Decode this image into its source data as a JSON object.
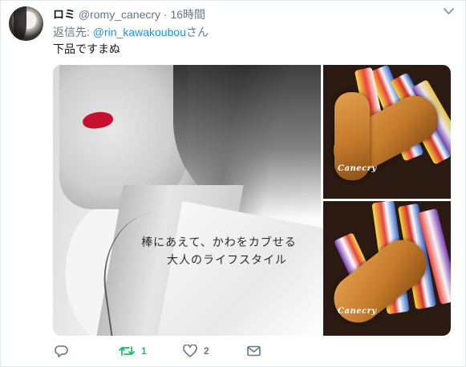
{
  "tweet": {
    "display_name": "ロミ",
    "handle": "@romy_canecry",
    "separator": "·",
    "time": "16時間",
    "reply_prefix": "返信先: ",
    "reply_to": "@rin_kawakoubou",
    "reply_suffix": "さん",
    "text": "下品ですまぬ"
  },
  "media": {
    "poster_line1": "棒にあえて、かわをカブせる",
    "poster_line2": "大人のライフスタイル",
    "brand_top": "Canecry",
    "brand_bottom": "Canecry"
  },
  "actions": {
    "reply_icon": "reply-icon",
    "retweet_icon": "retweet-icon",
    "retweet_count": "1",
    "like_icon": "heart-icon",
    "like_count": "2",
    "dm_icon": "envelope-icon",
    "retweet_color": "#17bf63",
    "icon_color": "#657786"
  },
  "colors": {
    "link": "#1b95e0",
    "muted": "#657786",
    "lipstick": "#c8102e"
  }
}
